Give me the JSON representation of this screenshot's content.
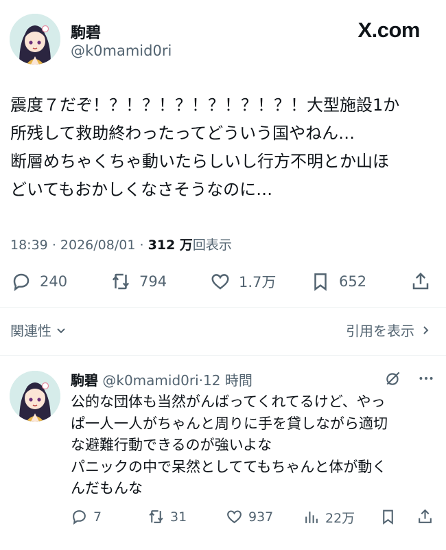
{
  "brand": "X.com",
  "tweet": {
    "author_name": "駒碧",
    "author_handle": "@k0mamid0ri",
    "body": "震度７だぞ！？！？！？！？！？！？！大型施設1か\n所残して救助終わったってどういう国やねん…\n断層めちゃくちゃ動いたらしいし行方不明とか山ほ\nどいてもおかしくなさそうなのに…",
    "time": "18:39",
    "date": "2026/08/01",
    "views_count": "312 万",
    "views_label": "回表示",
    "replies": "240",
    "retweets": "794",
    "likes": "1.7万",
    "bookmarks": "652"
  },
  "related": {
    "label": "関連性"
  },
  "quotes": {
    "label": "引用を表示"
  },
  "reply": {
    "author_name": "駒碧",
    "author_handle": "@k0mamid0ri",
    "time": "12 時間",
    "body": "公的な団体も当然がんばってくれてるけど、やっ\nぱ一人一人がちゃんと周りに手を貸しながら適切\nな避難行動できるのが強いよな\nパニックの中で呆然としててもちゃんと体が動く\nんだもんな",
    "replies": "7",
    "retweets": "31",
    "likes": "937",
    "views": "22万"
  },
  "icons": [
    "reply-icon",
    "retweet-icon",
    "like-icon",
    "bookmark-icon",
    "share-icon",
    "views-icon",
    "grok-icon",
    "more-icon"
  ]
}
